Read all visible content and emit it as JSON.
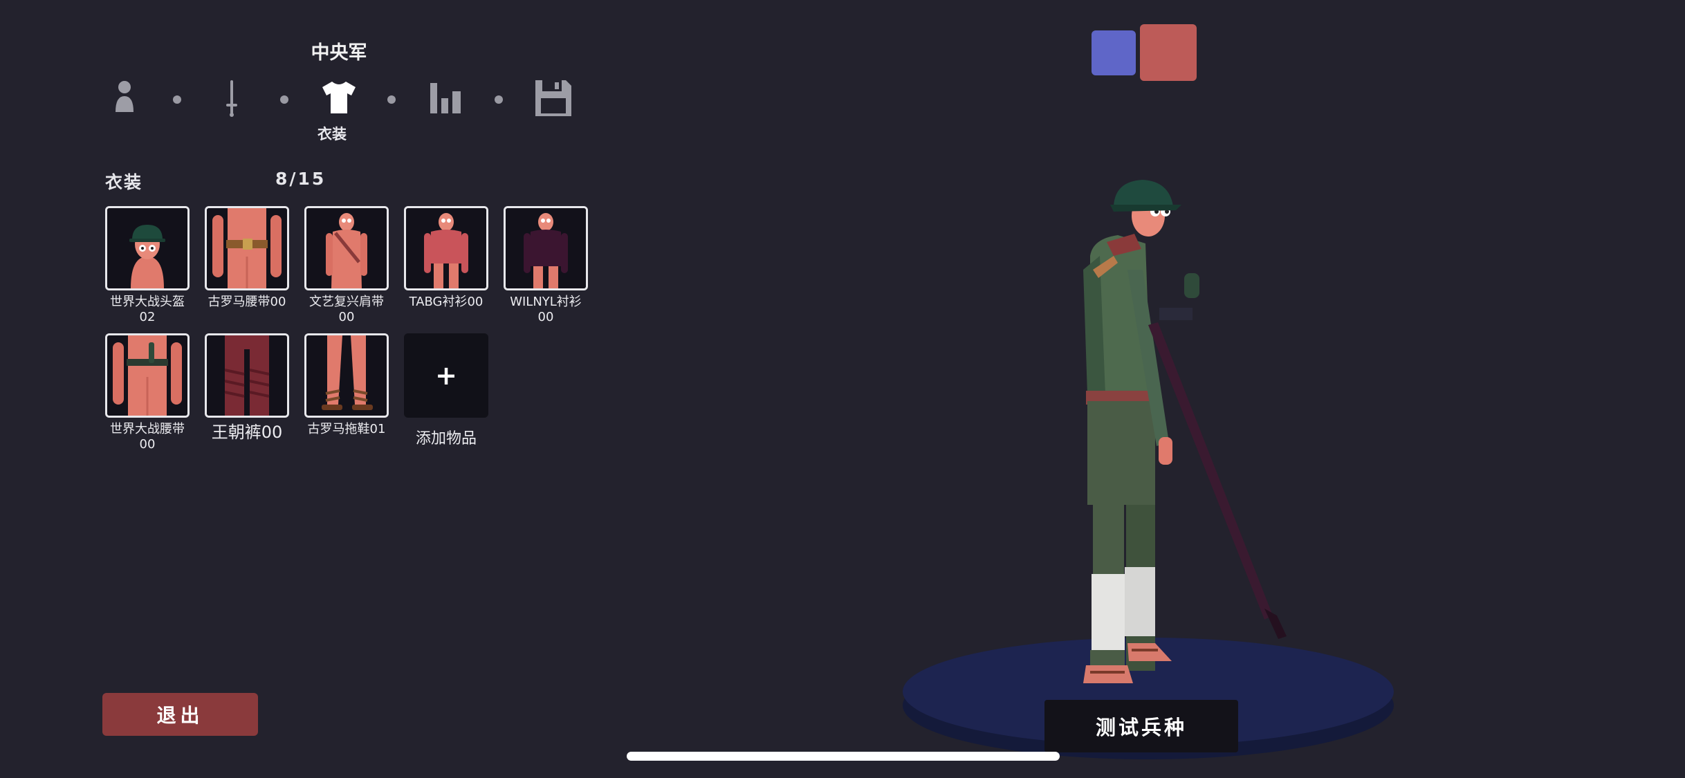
{
  "header": {
    "unit_name": "中央军",
    "steps": [
      {
        "icon": "person-icon"
      },
      {
        "icon": "sword-icon"
      },
      {
        "icon": "shirt-icon",
        "label": "衣装",
        "active": true
      },
      {
        "icon": "stats-icon"
      },
      {
        "icon": "save-icon"
      }
    ]
  },
  "clothing": {
    "title": "衣装",
    "count": "8/15",
    "items": [
      {
        "label": "世界大战头盔\n02",
        "icon": "helmet-item-icon"
      },
      {
        "label": "古罗马腰带00",
        "icon": "belt-item-icon"
      },
      {
        "label": "文艺复兴肩带\n00",
        "icon": "shoulder-strap-item-icon"
      },
      {
        "label": "TABG衬衫00",
        "icon": "shirt-item-icon"
      },
      {
        "label": "WILNYL衬衫\n00",
        "icon": "dark-shirt-item-icon"
      },
      {
        "label": "世界大战腰带\n00",
        "icon": "ww-belt-item-icon"
      },
      {
        "label": "王朝裤00",
        "icon": "pants-item-icon"
      },
      {
        "label": "古罗马拖鞋01",
        "icon": "sandals-item-icon"
      }
    ],
    "add": {
      "symbol": "+",
      "label": "添加物品"
    }
  },
  "buttons": {
    "exit": "退出",
    "test": "测试兵种"
  },
  "teams": {
    "blue": "#5f66c8",
    "red": "#bd5b58"
  }
}
